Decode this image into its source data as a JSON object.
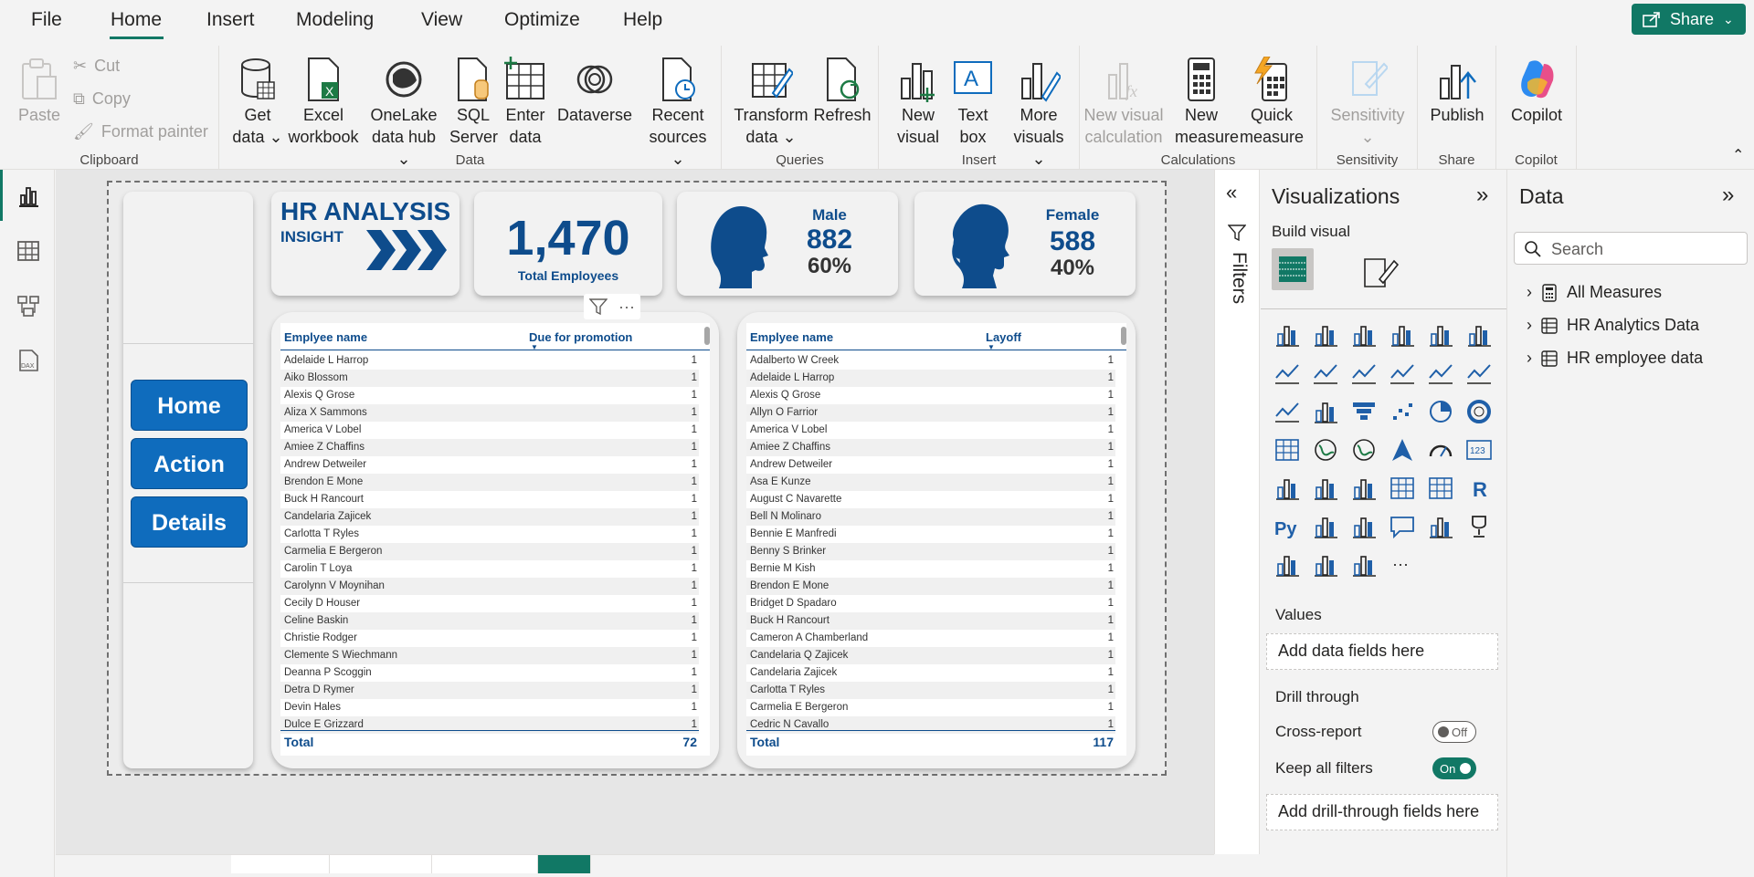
{
  "menu": {
    "items": [
      "File",
      "Home",
      "Insert",
      "Modeling",
      "View",
      "Optimize",
      "Help"
    ],
    "active": "Home",
    "share_label": "Share"
  },
  "ribbon": {
    "clipboard": {
      "paste": "Paste",
      "cut": "Cut",
      "copy": "Copy",
      "format_painter": "Format painter",
      "label": "Clipboard"
    },
    "data": {
      "get_data": [
        "Get",
        "data"
      ],
      "excel": [
        "Excel",
        "workbook"
      ],
      "onelake": [
        "OneLake",
        "data hub"
      ],
      "sql": [
        "SQL",
        "Server"
      ],
      "enter": [
        "Enter",
        "data"
      ],
      "dataverse": "Dataverse",
      "recent": [
        "Recent",
        "sources"
      ],
      "label": "Data"
    },
    "queries": {
      "transform": [
        "Transform",
        "data"
      ],
      "refresh": "Refresh",
      "label": "Queries"
    },
    "insert": {
      "new_visual": [
        "New",
        "visual"
      ],
      "text_box": [
        "Text",
        "box"
      ],
      "more_visuals": [
        "More",
        "visuals"
      ],
      "label": "Insert"
    },
    "calculations": {
      "new_visual_calc": [
        "New visual",
        "calculation"
      ],
      "new_measure": [
        "New",
        "measure"
      ],
      "quick_measure": [
        "Quick",
        "measure"
      ],
      "label": "Calculations"
    },
    "sensitivity": {
      "btn": "Sensitivity",
      "label": "Sensitivity"
    },
    "share": {
      "publish": "Publish",
      "label": "Share"
    },
    "copilot": {
      "btn": "Copilot",
      "label": "Copilot"
    }
  },
  "report": {
    "title_line1": "HR ANALYSIS",
    "title_line2": "INSIGHT",
    "total_employees_value": "1,470",
    "total_employees_label": "Total Employees",
    "male_label": "Male",
    "male_count": "882",
    "male_pct": "60%",
    "female_label": "Female",
    "female_count": "588",
    "female_pct": "40%",
    "nav": [
      "Home",
      "Action",
      "Details"
    ],
    "promotion_table": {
      "col1": "Emplyee name",
      "col2": "Due for promotion",
      "rows": [
        [
          "Adelaide L Harrop",
          "1"
        ],
        [
          "Aiko Blossom",
          "1"
        ],
        [
          "Alexis Q Grose",
          "1"
        ],
        [
          "Aliza X Sammons",
          "1"
        ],
        [
          "America V Lobel",
          "1"
        ],
        [
          "Amiee Z Chaffins",
          "1"
        ],
        [
          "Andrew Detweiler",
          "1"
        ],
        [
          "Brendon E Mone",
          "1"
        ],
        [
          "Buck H Rancourt",
          "1"
        ],
        [
          "Candelaria Zajicek",
          "1"
        ],
        [
          "Carlotta T Ryles",
          "1"
        ],
        [
          "Carmelia E Bergeron",
          "1"
        ],
        [
          "Carolin T Loya",
          "1"
        ],
        [
          "Carolynn V Moynihan",
          "1"
        ],
        [
          "Cecily D Houser",
          "1"
        ],
        [
          "Celine Baskin",
          "1"
        ],
        [
          "Christie Rodger",
          "1"
        ],
        [
          "Clemente S Wiechmann",
          "1"
        ],
        [
          "Deanna P Scoggin",
          "1"
        ],
        [
          "Detra D Rymer",
          "1"
        ],
        [
          "Devin Hales",
          "1"
        ],
        [
          "Dulce E Grizzard",
          "1"
        ]
      ],
      "total_label": "Total",
      "total_value": "72"
    },
    "layoff_table": {
      "col1": "Emplyee name",
      "col2": "Layoff",
      "rows": [
        [
          "Adalberto W Creek",
          "1"
        ],
        [
          "Adelaide L Harrop",
          "1"
        ],
        [
          "Alexis Q Grose",
          "1"
        ],
        [
          "Allyn O Farrior",
          "1"
        ],
        [
          "America V Lobel",
          "1"
        ],
        [
          "Amiee Z Chaffins",
          "1"
        ],
        [
          "Andrew Detweiler",
          "1"
        ],
        [
          "Asa E Kunze",
          "1"
        ],
        [
          "August C Navarette",
          "1"
        ],
        [
          "Bell N Molinaro",
          "1"
        ],
        [
          "Bennie E Manfredi",
          "1"
        ],
        [
          "Benny S Brinker",
          "1"
        ],
        [
          "Bernie M Kish",
          "1"
        ],
        [
          "Brendon E Mone",
          "1"
        ],
        [
          "Bridget D Spadaro",
          "1"
        ],
        [
          "Buck H Rancourt",
          "1"
        ],
        [
          "Cameron A Chamberland",
          "1"
        ],
        [
          "Candelaria Q Zajicek",
          "1"
        ],
        [
          "Candelaria Zajicek",
          "1"
        ],
        [
          "Carlotta T Ryles",
          "1"
        ],
        [
          "Carmelia E Bergeron",
          "1"
        ],
        [
          "Cedric N Cavallo",
          "1"
        ]
      ],
      "total_label": "Total",
      "total_value": "117"
    }
  },
  "filters": {
    "label": "Filters"
  },
  "visualizations": {
    "title": "Visualizations",
    "build_visual": "Build visual",
    "values_label": "Values",
    "values_placeholder": "Add data fields here",
    "drill_through": "Drill through",
    "cross_report": "Cross-report",
    "cross_report_state": "Off",
    "keep_all_filters": "Keep all filters",
    "keep_all_filters_state": "On",
    "drill_placeholder": "Add drill-through fields here",
    "more": "..."
  },
  "data_pane": {
    "title": "Data",
    "search_placeholder": "Search",
    "items": [
      "All Measures",
      "HR Analytics Data",
      "HR employee data"
    ]
  },
  "colors": {
    "accent": "#117865",
    "brand_blue": "#0e4c8c",
    "nav_blue": "#0f6cbd"
  }
}
